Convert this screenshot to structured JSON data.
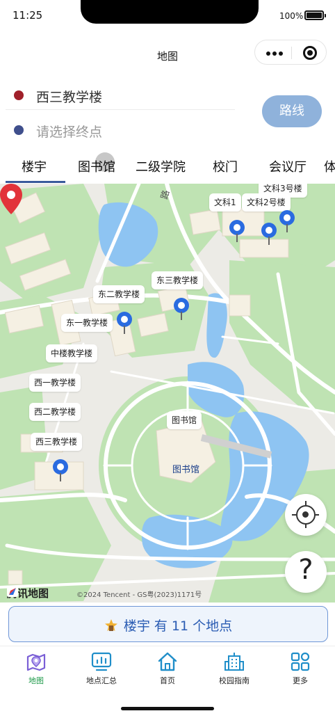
{
  "status_bar": {
    "time": "11:25",
    "battery": "100%"
  },
  "nav": {
    "title": "地图"
  },
  "route": {
    "start": "西三教学楼",
    "end_placeholder": "请选择终点",
    "button": "路线",
    "start_color": "#a0202a",
    "end_color": "#3f4f8c"
  },
  "tabs": [
    {
      "label": "楼宇",
      "active": true
    },
    {
      "label": "图书馆"
    },
    {
      "label": "二级学院"
    },
    {
      "label": "校门"
    },
    {
      "label": "会议厅"
    },
    {
      "label": "体"
    }
  ],
  "map": {
    "road_label": "路",
    "poi_labels": [
      "文科3号楼",
      "文科1",
      "文科2号楼",
      "东三教学楼",
      "东二教学楼",
      "东一教学楼",
      "中楼教学楼",
      "西一教学楼",
      "西二教学楼",
      "西三教学楼",
      "图书馆"
    ],
    "library_marker_label": "图书馆",
    "brand": "腾讯地图",
    "copyright": "©2024 Tencent - GS粤(2023)1171号",
    "help_symbol": "?",
    "colors": {
      "land": "#ecebe6",
      "green": "#bfe3b3",
      "water": "#8ec4f2",
      "road": "#ffffff",
      "building": "#f5f0e3"
    }
  },
  "summary": {
    "text": "楼宇 有 11 个地点"
  },
  "tabbar": [
    {
      "label": "地图",
      "icon": "map-icon",
      "active": true
    },
    {
      "label": "地点汇总",
      "icon": "chart-screen-icon"
    },
    {
      "label": "首页",
      "icon": "home-icon"
    },
    {
      "label": "校园指南",
      "icon": "building-icon"
    },
    {
      "label": "更多",
      "icon": "grid-icon"
    }
  ]
}
